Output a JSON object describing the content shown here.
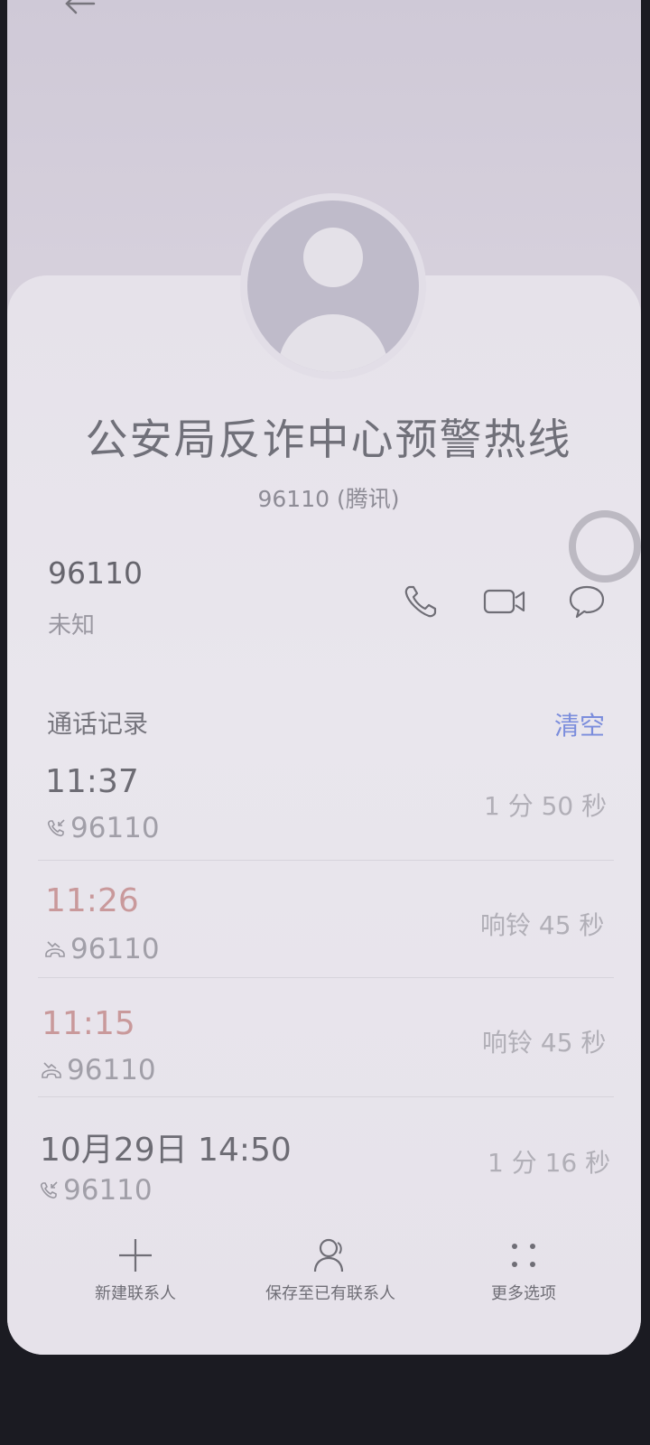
{
  "header": {
    "back_icon": "back-arrow-icon"
  },
  "contact": {
    "name": "公安局反诈中心预警热线",
    "subtitle": "96110 (腾讯)",
    "number": "96110",
    "location": "未知"
  },
  "actions": [
    {
      "icon": "phone-icon"
    },
    {
      "icon": "video-call-icon"
    },
    {
      "icon": "message-icon"
    }
  ],
  "call_log": {
    "title": "通话记录",
    "clear_label": "清空",
    "entries": [
      {
        "time": "11:37",
        "number": "96110",
        "duration": "1 分 50 秒",
        "type": "incoming"
      },
      {
        "time": "11:26",
        "number": "96110",
        "duration": "响铃 45 秒",
        "type": "missed"
      },
      {
        "time": "11:15",
        "number": "96110",
        "duration": "响铃 45 秒",
        "type": "missed"
      },
      {
        "time": "10月29日 14:50",
        "number": "96110",
        "duration": "1 分 16 秒",
        "type": "incoming"
      }
    ]
  },
  "bottom_bar": {
    "new_contact": "新建联系人",
    "save_existing": "保存至已有联系人",
    "more_options": "更多选项"
  },
  "colors": {
    "missed": "#c9999b",
    "accent": "#7b8ddc"
  }
}
